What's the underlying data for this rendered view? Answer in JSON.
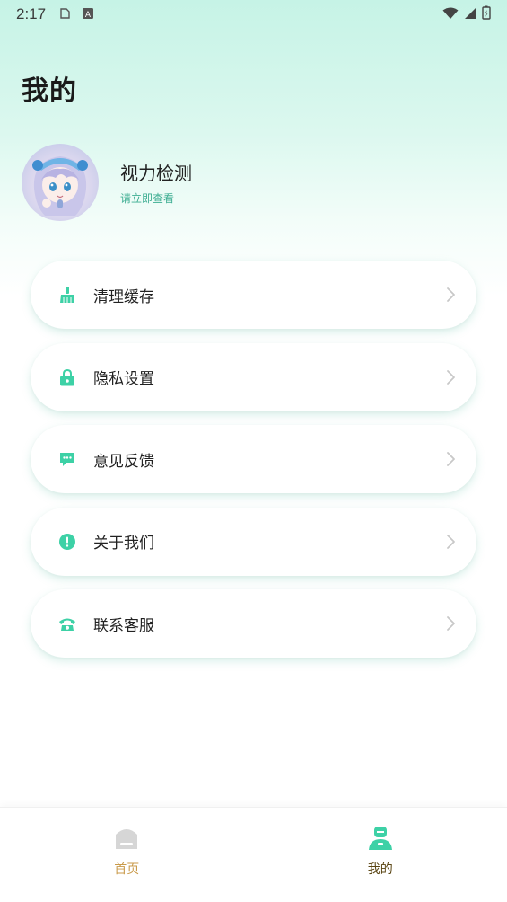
{
  "status_bar": {
    "time": "2:17"
  },
  "page": {
    "title": "我的"
  },
  "profile": {
    "name": "视力检测",
    "subtitle": "请立即查看"
  },
  "menu": {
    "items": [
      {
        "label": "清理缓存",
        "icon": "broom-icon"
      },
      {
        "label": "隐私设置",
        "icon": "lock-icon"
      },
      {
        "label": "意见反馈",
        "icon": "message-icon"
      },
      {
        "label": "关于我们",
        "icon": "info-icon"
      },
      {
        "label": "联系客服",
        "icon": "phone-icon"
      }
    ]
  },
  "tabs": [
    {
      "label": "首页",
      "icon": "home-icon",
      "active": false
    },
    {
      "label": "我的",
      "icon": "user-icon",
      "active": true
    }
  ],
  "colors": {
    "accent": "#3dd1a6",
    "gold": "#c99a4a",
    "active_label": "#5a4513"
  }
}
